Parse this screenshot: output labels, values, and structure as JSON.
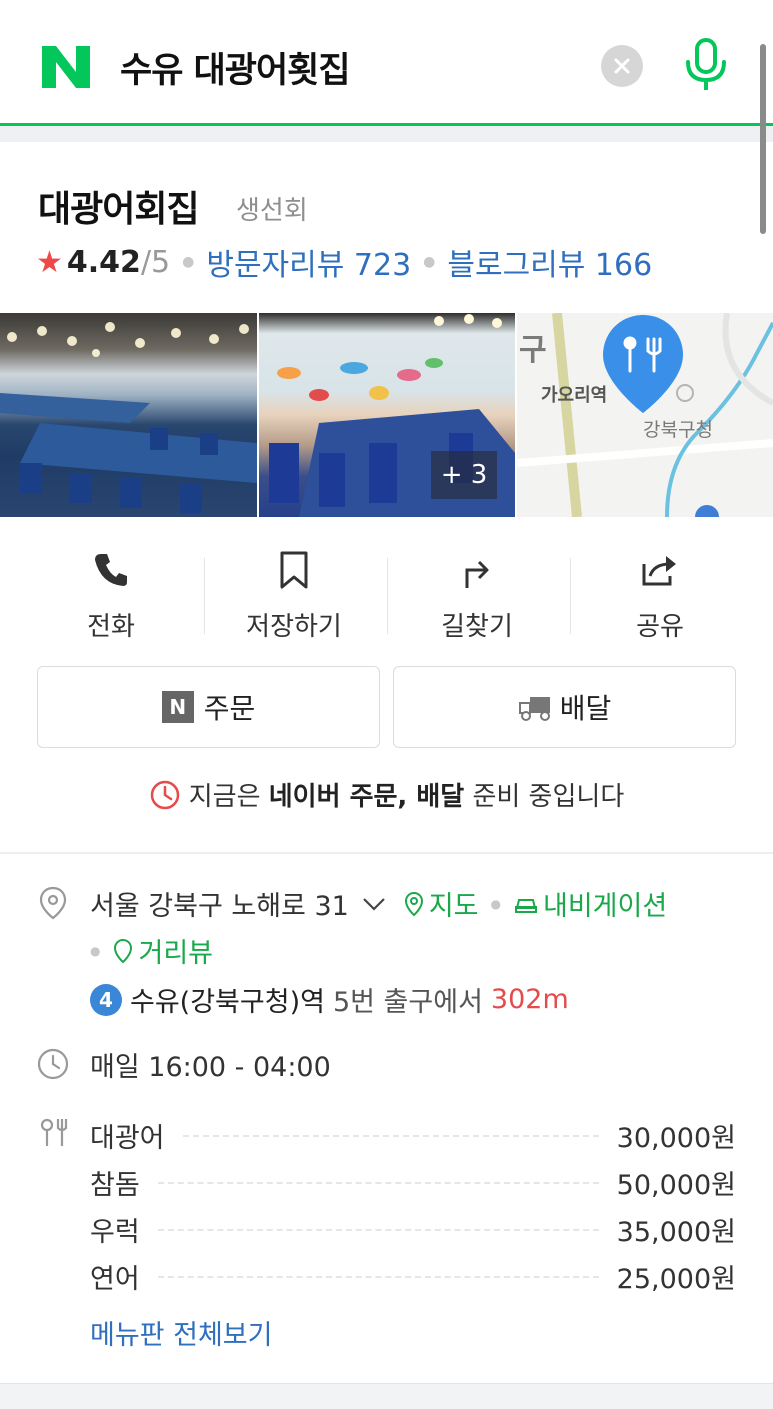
{
  "search": {
    "logo_letter": "N",
    "query": "수유 대광어횟집",
    "clear_icon": "close-icon",
    "mic_icon": "microphone-icon"
  },
  "place": {
    "name": "대광어회집",
    "category": "생선회",
    "star": "★",
    "rating": "4.42",
    "rating_max": "/5",
    "visitor_reviews": "방문자리뷰 723",
    "blog_reviews": "블로그리뷰 166"
  },
  "photos": {
    "more_count": "+ 3",
    "map_labels": [
      "구",
      "가오리역",
      "강북구청"
    ]
  },
  "actions": [
    {
      "label": "전화",
      "icon": "phone-icon"
    },
    {
      "label": "저장하기",
      "icon": "bookmark-icon"
    },
    {
      "label": "길찾기",
      "icon": "directions-icon"
    },
    {
      "label": "공유",
      "icon": "share-icon"
    }
  ],
  "buttons": {
    "order_badge": "N",
    "order_label": "주문",
    "delivery_label": "배달"
  },
  "notice": {
    "prefix": "지금은",
    "bold": "네이버 주문, 배달",
    "suffix": "준비 중입니다"
  },
  "info": {
    "address": "서울 강북구 노해로 31",
    "map_link": "지도",
    "navigation_link": "내비게이션",
    "street_view_link": "거리뷰",
    "subway_line": "4",
    "subway_text": "수유(강북구청)역",
    "exit_text": "5번 출구에서",
    "distance": "302m",
    "hours": "매일 16:00 - 04:00"
  },
  "menu": {
    "items": [
      {
        "name": "대광어",
        "price": "30,000원"
      },
      {
        "name": "참돔",
        "price": "50,000원"
      },
      {
        "name": "우럭",
        "price": "35,000원"
      },
      {
        "name": "연어",
        "price": "25,000원"
      }
    ],
    "view_all": "메뉴판 전체보기"
  },
  "colors": {
    "naver_green": "#03c75a",
    "link_blue": "#2f6fbe",
    "star_red": "#f04848",
    "distance_red": "#e54b4b",
    "subway_line4": "#3a87d8"
  }
}
